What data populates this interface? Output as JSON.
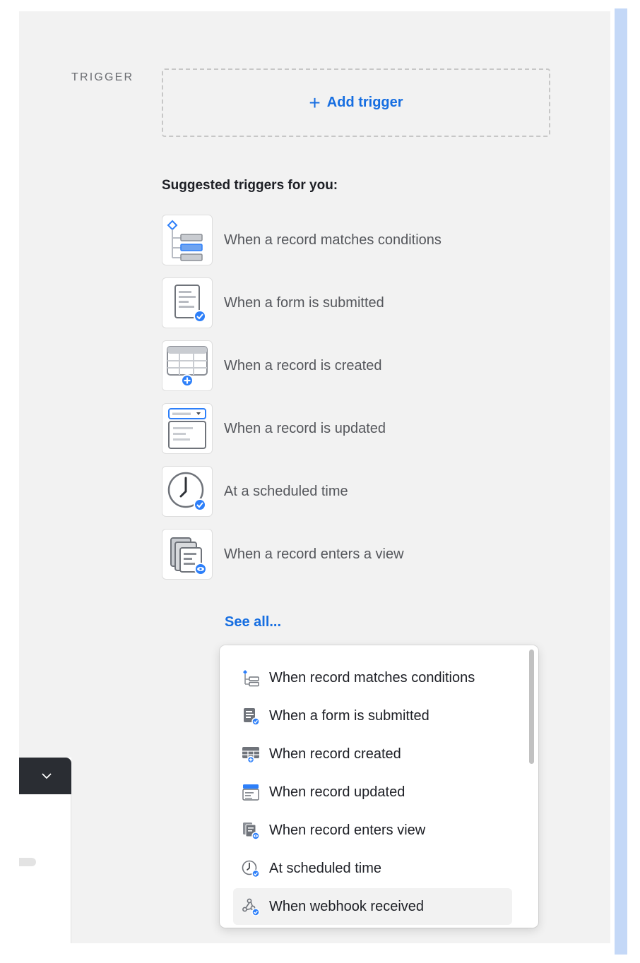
{
  "trigger_section": {
    "label": "TRIGGER",
    "add_trigger_plus": "+",
    "add_trigger_label": "Add trigger"
  },
  "suggestions": {
    "heading": "Suggested triggers for you:",
    "items": [
      {
        "label": "When a record matches conditions",
        "icon": "conditions-icon"
      },
      {
        "label": "When a form is submitted",
        "icon": "form-submitted-icon"
      },
      {
        "label": "When a record is created",
        "icon": "record-created-icon"
      },
      {
        "label": "When a record is updated",
        "icon": "record-updated-icon"
      },
      {
        "label": "At a scheduled time",
        "icon": "clock-icon"
      },
      {
        "label": "When a record enters a view",
        "icon": "record-enters-view-icon"
      }
    ],
    "see_all": "See all..."
  },
  "dropdown": {
    "items": [
      {
        "label": "When record matches conditions",
        "icon": "conditions-icon"
      },
      {
        "label": "When a form is submitted",
        "icon": "form-submitted-icon"
      },
      {
        "label": "When record created",
        "icon": "record-created-icon"
      },
      {
        "label": "When record updated",
        "icon": "record-updated-icon"
      },
      {
        "label": "When record enters view",
        "icon": "record-enters-view-icon"
      },
      {
        "label": "At scheduled time",
        "icon": "clock-icon"
      },
      {
        "label": "When webhook received",
        "icon": "webhook-icon"
      }
    ],
    "highlighted_item": "When webhook received"
  },
  "colors": {
    "accent": "#166ee1",
    "canvas_bg": "#f2f2f2",
    "panel_dark": "#2a2d33",
    "right_strip": "#c4d8f7"
  }
}
